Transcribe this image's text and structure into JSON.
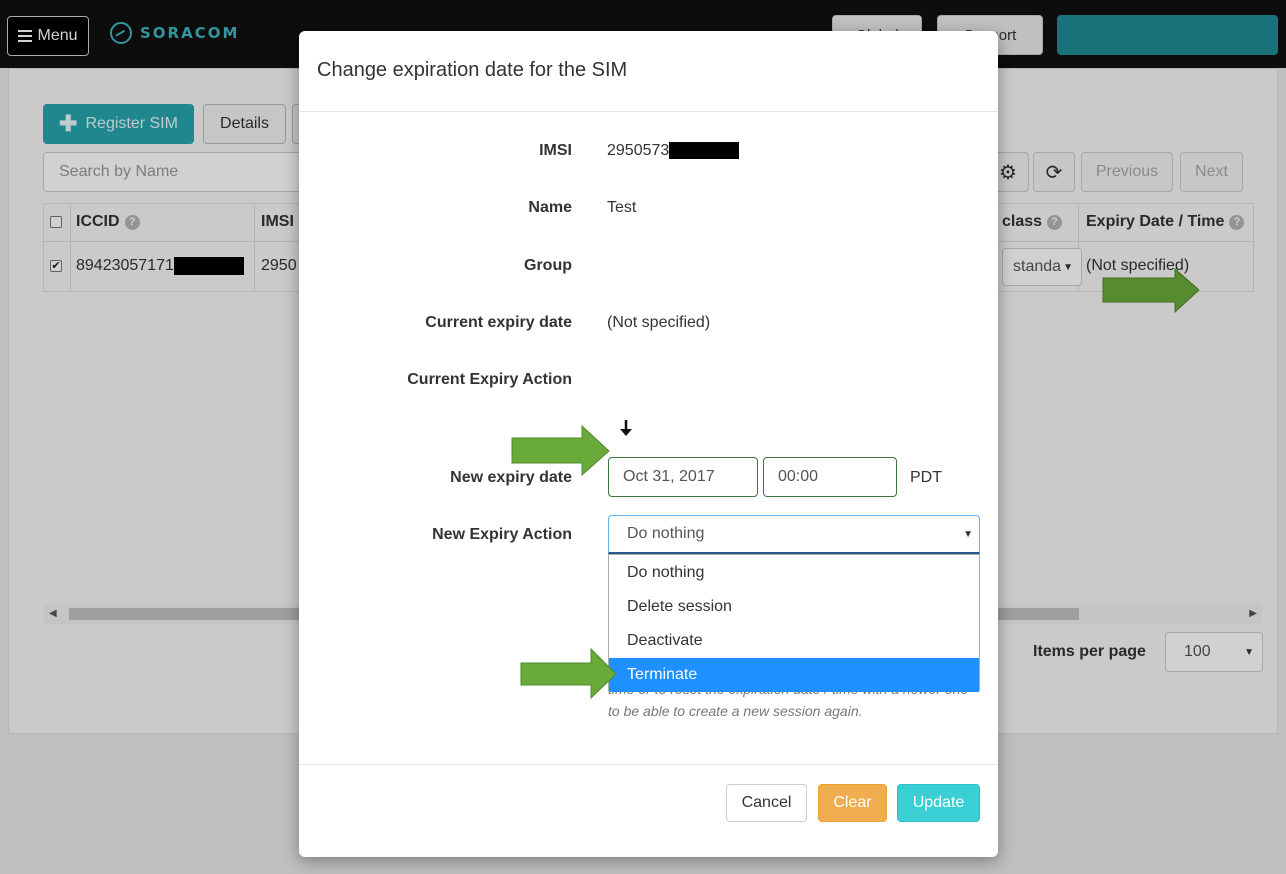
{
  "header": {
    "menu_label": "Menu",
    "logo_text": "SORACOM",
    "pill_global": "Global",
    "pill_support": "Support"
  },
  "toolbar": {
    "register_sim": "Register SIM",
    "details": "Details"
  },
  "search": {
    "placeholder": "Search by Name"
  },
  "pager": {
    "previous": "Previous",
    "next": "Next"
  },
  "table": {
    "columns": {
      "iccid": "ICCID",
      "imsi": "IMSI",
      "speed_class": "class",
      "expiry": "Expiry Date / Time"
    },
    "row": {
      "iccid": "89423057171",
      "imsi": "2950",
      "speed_class": "standa",
      "expiry": "(Not specified)"
    }
  },
  "items_per_page": {
    "label": "Items per page",
    "value": "100"
  },
  "modal": {
    "title": "Change expiration date for the SIM",
    "labels": {
      "imsi": "IMSI",
      "name": "Name",
      "group": "Group",
      "current_expiry_date": "Current expiry date",
      "current_expiry_action": "Current Expiry Action",
      "new_expiry_date": "New expiry date",
      "new_expiry_action": "New Expiry Action"
    },
    "values": {
      "imsi": "2950573",
      "name": "Test",
      "group": "",
      "current_expiry_date": "(Not specified)",
      "current_expiry_action": ""
    },
    "new_date": "Oct 31, 2017",
    "new_time": "00:00",
    "timezone": "PDT",
    "action_selected": "Do nothing",
    "action_options": [
      "Do nothing",
      "Delete session",
      "Deactivate",
      "Terminate"
    ],
    "highlighted_option": "Terminate",
    "help_line_1": "time or to reset the expiration date / time with a newer one",
    "help_line_2": "to be able to create a new session again.",
    "buttons": {
      "cancel": "Cancel",
      "clear": "Clear",
      "update": "Update"
    }
  },
  "colors": {
    "brand": "#3fb6c1",
    "register_button": "#26a5ae",
    "clear_button": "#f0ad4e",
    "update_button": "#3acfd5",
    "highlight": "#1e90ff",
    "annotation_arrow": "#6aaa3a"
  }
}
